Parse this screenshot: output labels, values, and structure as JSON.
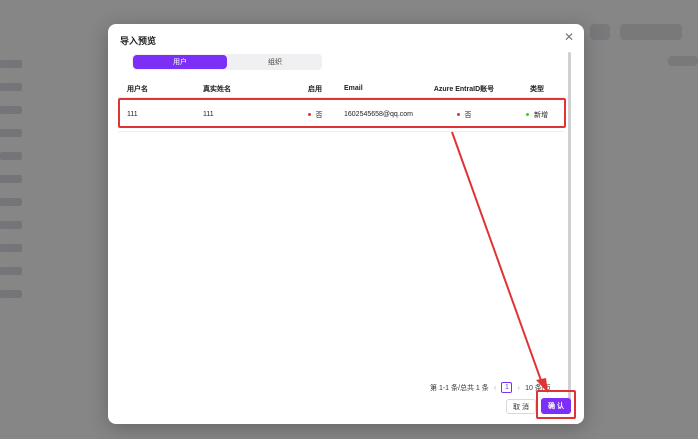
{
  "modal": {
    "title": "导入预览",
    "close_icon": "close-icon"
  },
  "tabs": [
    {
      "label": "用户",
      "active": true
    },
    {
      "label": "组织",
      "active": false
    }
  ],
  "table": {
    "headers": [
      "用户名",
      "真实姓名",
      "启用",
      "Email",
      "Azure EntraID账号",
      "类型"
    ],
    "rows": [
      {
        "username": "111",
        "realname": "111",
        "enabled": "否",
        "enabled_color": "#e03434",
        "email": "1602545658@qq.com",
        "azure": "否",
        "azure_color": "#e03434",
        "type": "新增",
        "type_color": "#52c41a"
      }
    ]
  },
  "pagination": {
    "summary": "第 1-1 条/总共 1 条",
    "current_page": "1",
    "per_page": "10 条/页"
  },
  "buttons": {
    "cancel": "取 消",
    "confirm": "确 认"
  },
  "colors": {
    "accent": "#7b2ff7",
    "annotation": "#e03434"
  }
}
